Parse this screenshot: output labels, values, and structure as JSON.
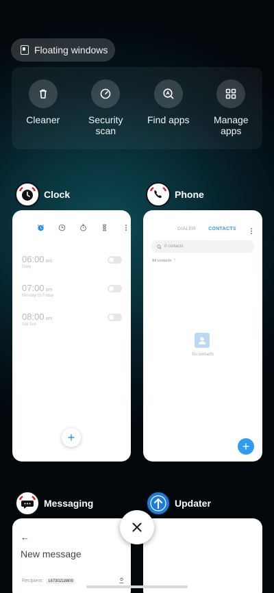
{
  "floating_windows": {
    "label": "Floating windows"
  },
  "quick_actions": [
    {
      "label": "Cleaner",
      "icon": "trash-icon"
    },
    {
      "label": "Security\nscan",
      "icon": "security-gauge-icon"
    },
    {
      "label": "Find apps",
      "icon": "find-apps-icon"
    },
    {
      "label": "Manage\napps",
      "icon": "grid-icon"
    }
  ],
  "apps": {
    "clock": {
      "name": "Clock",
      "alarms": [
        {
          "time": "06:00",
          "ampm": "am",
          "repeat": "Daily"
        },
        {
          "time": "07:00",
          "ampm": "am",
          "repeat": "Monday to Friday"
        },
        {
          "time": "08:00",
          "ampm": "am",
          "repeat": "Sat Sun"
        }
      ],
      "fab": "+"
    },
    "phone": {
      "name": "Phone",
      "tabs": [
        "DIALER",
        "CONTACTS"
      ],
      "search_placeholder": "0 contacts",
      "filter": "All contacts",
      "empty_text": "No contacts",
      "fab": "+"
    },
    "messaging": {
      "name": "Messaging",
      "title": "New message",
      "recipient_label": "Recipient:",
      "recipient_value": "18730218809"
    },
    "updater": {
      "name": "Updater"
    }
  },
  "colors": {
    "accent": "#2f9cf0",
    "clock_blue": "#2d8ee8"
  }
}
